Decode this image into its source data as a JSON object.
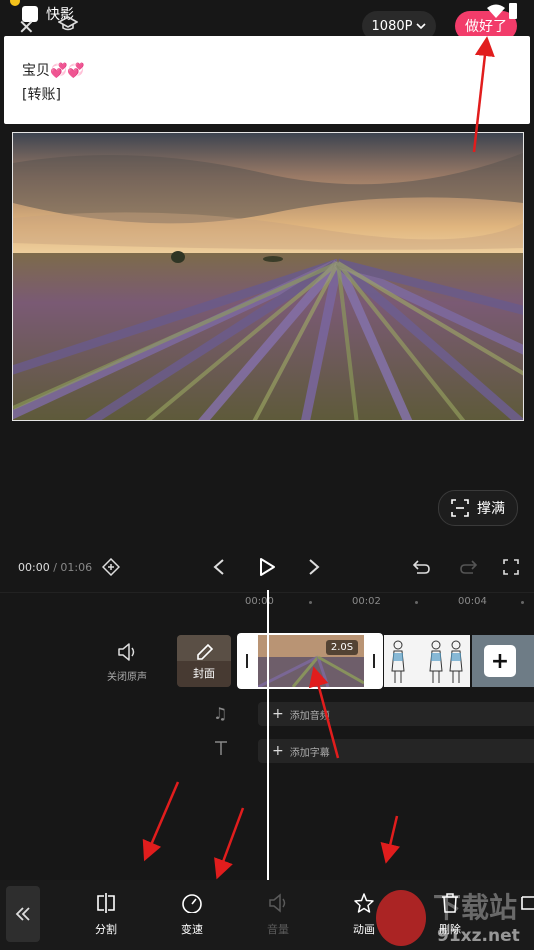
{
  "status_bar": {
    "app_name": "快影"
  },
  "header": {
    "resolution": "1080P",
    "done_label": "做好了"
  },
  "notification": {
    "line1": "宝贝💞💞",
    "line2": "[转账]"
  },
  "preview": {
    "fill_label": "撑满"
  },
  "playback": {
    "current_time": "00:00",
    "total_time": "/ 01:06"
  },
  "timeline": {
    "ticks": [
      "00:00",
      "00:02",
      "00:04"
    ],
    "mute_label": "关闭原声",
    "cover_label": "封面",
    "clip_duration": "2.0S",
    "add_audio_label": "添加音频",
    "add_subtitle_label": "添加字幕"
  },
  "toolbar": {
    "items": [
      {
        "label": "分割",
        "icon": "split-icon",
        "enabled": true
      },
      {
        "label": "变速",
        "icon": "speed-icon",
        "enabled": true
      },
      {
        "label": "音量",
        "icon": "volume-icon",
        "enabled": false
      },
      {
        "label": "动画",
        "icon": "star-icon",
        "enabled": true
      },
      {
        "label": "删除",
        "icon": "trash-icon",
        "enabled": true
      }
    ]
  },
  "watermark": {
    "text": "下载站",
    "url": "91xz.net"
  },
  "colors": {
    "accent": "#f23c6a",
    "background": "#171717",
    "annotation_arrow": "#e11d1d"
  }
}
